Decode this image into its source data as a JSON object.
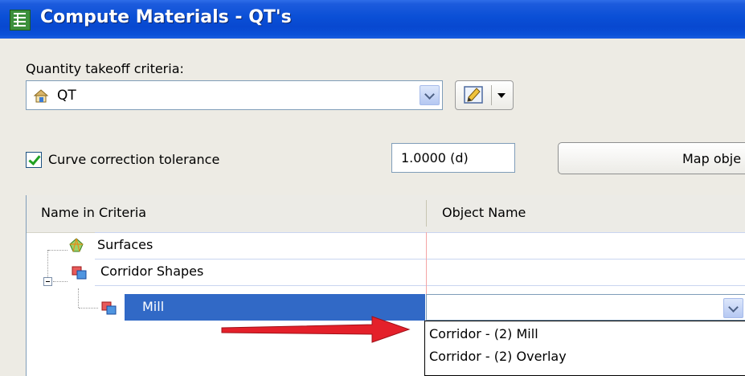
{
  "window": {
    "title": "Compute Materials - QT's"
  },
  "criteria": {
    "label": "Quantity takeoff criteria:",
    "value": "QT"
  },
  "curve": {
    "checked": true,
    "label": "Curve correction tolerance",
    "tolerance": "1.0000 (d)"
  },
  "map_button": {
    "label": "Map obje"
  },
  "table": {
    "columns": [
      "Name in Criteria",
      "Object Name"
    ],
    "rows": [
      {
        "name": "Surfaces",
        "icon": "surface-icon",
        "object": ""
      },
      {
        "name": "Corridor Shapes",
        "icon": "corridor-shapes-icon",
        "object": "",
        "expanded": true
      },
      {
        "name": "Mill",
        "icon": "shape-icon",
        "object": "",
        "selected": true
      }
    ],
    "dropdown_options": [
      "Corridor - (2) Mill",
      "Corridor - (2) Overlay"
    ]
  },
  "colors": {
    "titlebar": "#0A4FD6",
    "selection": "#3169C6",
    "arrow": "#E4202A",
    "check": "#21A121"
  }
}
